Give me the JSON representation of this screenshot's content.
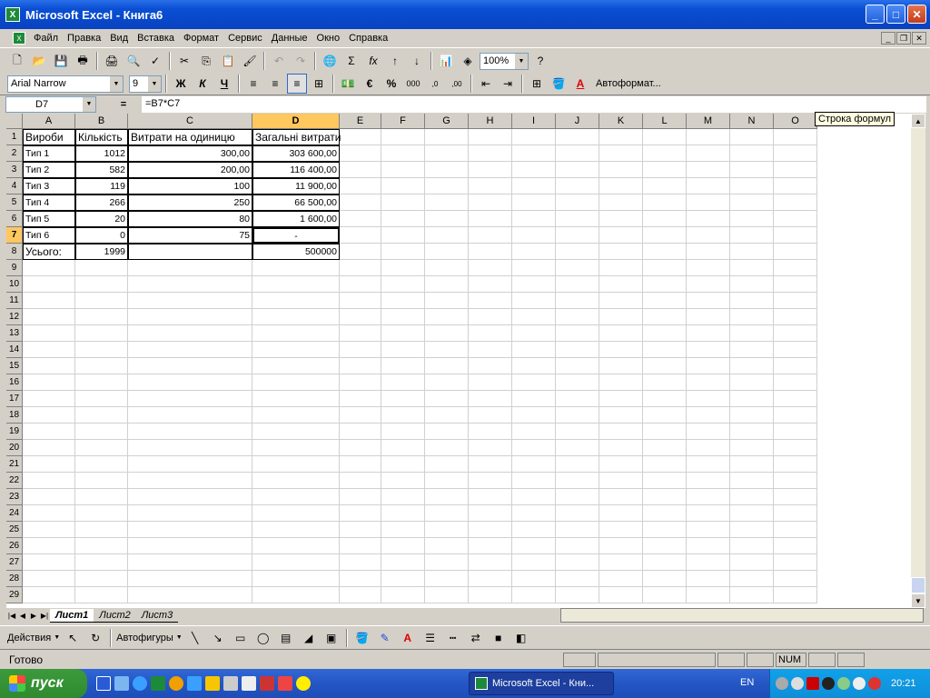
{
  "window": {
    "title": "Microsoft Excel - Книга6",
    "app_icon": "X"
  },
  "menu": [
    "Файл",
    "Правка",
    "Вид",
    "Вставка",
    "Формат",
    "Сервис",
    "Данные",
    "Окно",
    "Справка"
  ],
  "toolbar": {
    "zoom": "100%"
  },
  "format_toolbar": {
    "font": "Arial Narrow",
    "size": "9",
    "bold": "Ж",
    "italic": "К",
    "underline": "Ч",
    "autoformat": "Автоформат..."
  },
  "formula_bar": {
    "cell_ref": "D7",
    "eq": "=",
    "formula": "=B7*C7",
    "tooltip": "Строка формул"
  },
  "columns": [
    "A",
    "B",
    "C",
    "D",
    "E",
    "F",
    "G",
    "H",
    "I",
    "J",
    "K",
    "L",
    "M",
    "N",
    "O"
  ],
  "rows": [
    "1",
    "2",
    "3",
    "4",
    "5",
    "6",
    "7",
    "8",
    "9",
    "10",
    "11",
    "12",
    "13",
    "14",
    "15",
    "16",
    "17",
    "18",
    "19",
    "20",
    "21",
    "22",
    "23",
    "24",
    "25",
    "26",
    "27",
    "28",
    "29"
  ],
  "table": {
    "header": [
      "Вироби",
      "Кількість",
      "Витрати на одиницю",
      "Загальні витрати"
    ],
    "data": [
      [
        "Тип 1",
        "1012",
        "300,00",
        "303 600,00"
      ],
      [
        "Тип 2",
        "582",
        "200,00",
        "116 400,00"
      ],
      [
        "Тип 3",
        "119",
        "100",
        "11 900,00"
      ],
      [
        "Тип 4",
        "266",
        "250",
        "66 500,00"
      ],
      [
        "Тип 5",
        "20",
        "80",
        "1 600,00"
      ],
      [
        "Тип 6",
        "0",
        "75",
        "-"
      ]
    ],
    "total": [
      "Усього:",
      "1999",
      "",
      "500000"
    ]
  },
  "sheet_tabs": [
    "Лист1",
    "Лист2",
    "Лист3"
  ],
  "draw_toolbar": {
    "actions": "Действия",
    "autoshapes": "Автофигуры"
  },
  "status": {
    "text": "Готово",
    "num": "NUM"
  },
  "taskbar": {
    "start": "пуск",
    "task": "Microsoft Excel - Кни...",
    "lang": "EN",
    "clock": "20:21"
  }
}
